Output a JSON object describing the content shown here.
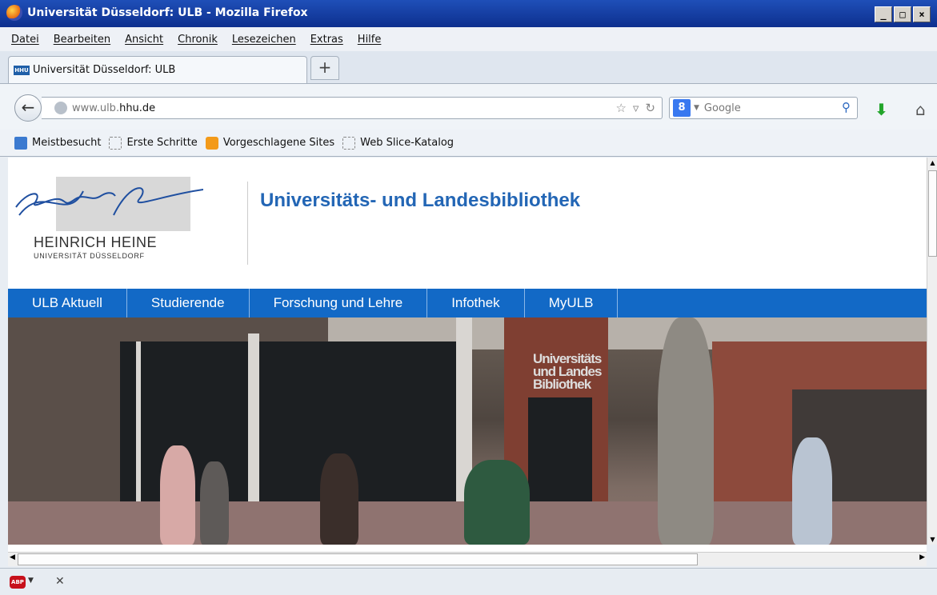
{
  "window": {
    "title": "Universität Düsseldorf: ULB - Mozilla Firefox",
    "minimize": "_",
    "maximize": "□",
    "close": "×"
  },
  "menubar": {
    "items": [
      "Datei",
      "Bearbeiten",
      "Ansicht",
      "Chronik",
      "Lesezeichen",
      "Extras",
      "Hilfe"
    ]
  },
  "tabs": {
    "active_title": "Universität Düsseldorf: ULB",
    "favicon_text": "HHU",
    "new_tab_label": "+"
  },
  "navbar": {
    "url_prefix": "www.ulb.",
    "url_domain": "hhu.de",
    "search_engine_label": "8",
    "search_placeholder": "Google"
  },
  "bookmarks": {
    "items": [
      "Meistbesucht",
      "Erste Schritte",
      "Vorgeschlagene Sites",
      "Web Slice-Katalog"
    ]
  },
  "page": {
    "logo_name": "HEINRICH HEINE",
    "logo_subtitle": "UNIVERSITÄT DÜSSELDORF",
    "site_title": "Universitäts- und Landesbibliothek",
    "nav": [
      "ULB Aktuell",
      "Studierende",
      "Forschung und Lehre",
      "Infothek",
      "MyULB"
    ],
    "hero_sign": [
      "Universitäts",
      "und Landes",
      "Bibliothek"
    ]
  },
  "colors": {
    "titlebar": "#1f4fb8",
    "nav_blue": "#1269c6",
    "title_blue": "#2366b5"
  }
}
